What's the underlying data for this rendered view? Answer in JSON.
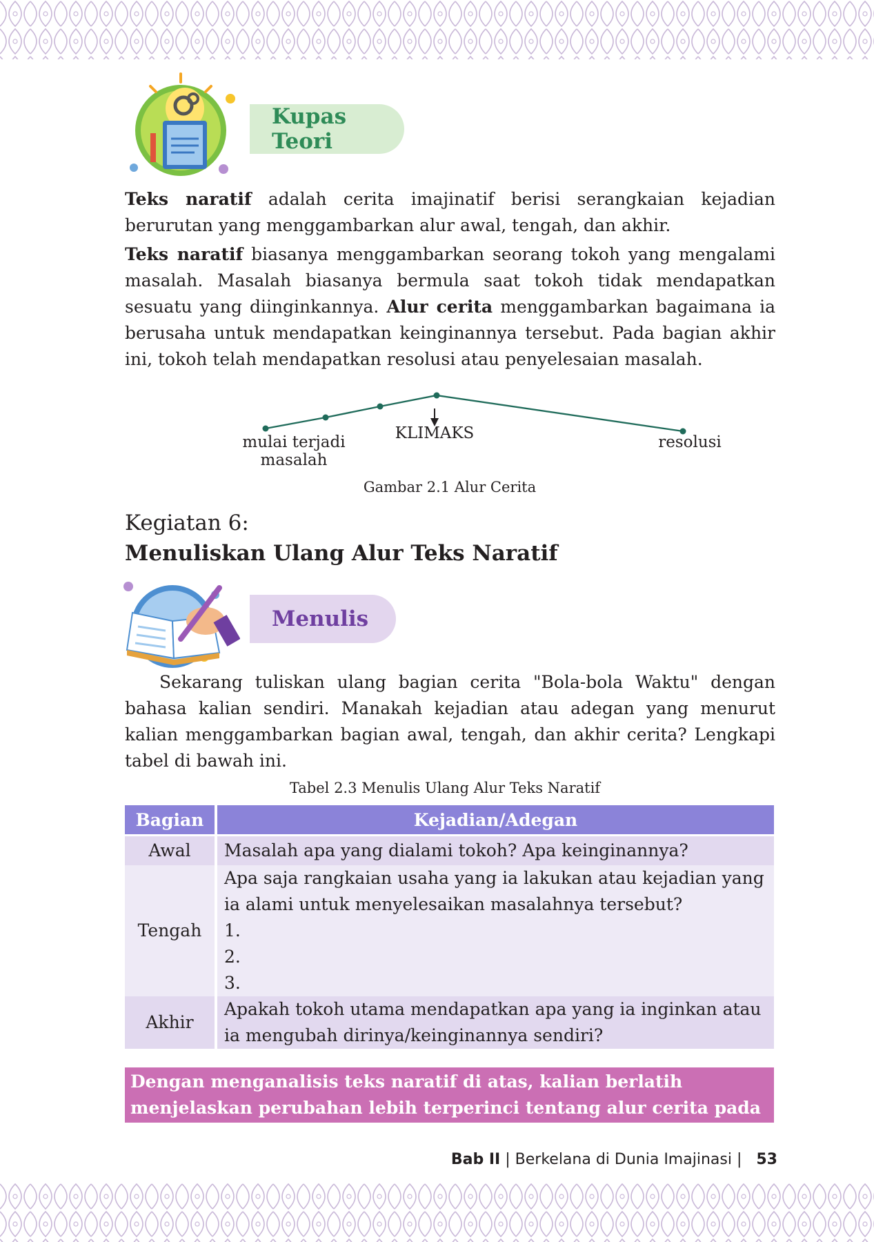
{
  "section1": {
    "badge": "Kupas Teori",
    "para1_bold": "Teks naratif",
    "para1_rest": " adalah cerita imajinatif berisi serangkaian kejadian berurutan yang menggambarkan alur awal, tengah, dan akhir.",
    "para2_bold1": "Teks naratif",
    "para2_mid": " biasanya menggambarkan seorang tokoh yang mengalami masalah. Masalah biasanya bermula saat tokoh tidak mendapatkan sesuatu yang diinginkannya. ",
    "para2_bold2": "Alur cerita",
    "para2_end": " menggambarkan bagaimana ia berusaha untuk mendapatkan keinginannya tersebut. Pada bagian akhir ini, tokoh telah mendapatkan resolusi atau penyelesaian masalah."
  },
  "figure": {
    "label_start": "mulai terjadi masalah",
    "label_peak": "KLIMAKS",
    "label_end": "resolusi",
    "caption": "Gambar 2.1 Alur Cerita",
    "line_color": "#1f6b5a"
  },
  "kegiatan": {
    "number": "Kegiatan 6:",
    "title": "Menuliskan Ulang Alur Teks Naratif"
  },
  "section2": {
    "badge": "Menulis",
    "instruction": "Sekarang tuliskan ulang bagian cerita \"Bola-bola Waktu\" dengan bahasa kalian sendiri. Manakah kejadian atau adegan yang menurut kalian menggambarkan bagian awal, tengah, dan akhir cerita? Lengkapi tabel di bawah ini."
  },
  "table": {
    "caption": "Tabel 2.3 Menulis Ulang Alur Teks Naratif",
    "headers": [
      "Bagian",
      "Kejadian/Adegan"
    ],
    "rows": [
      {
        "part": "Awal",
        "text": "Masalah apa yang dialami tokoh? Apa keinginannya?"
      },
      {
        "part": "Tengah",
        "text": "Apa saja rangkaian usaha yang ia lakukan atau kejadian yang ia alami untuk menyelesaikan masalahnya tersebut?",
        "items": [
          "1.",
          "2.",
          "3."
        ]
      },
      {
        "part": "Akhir",
        "text": "Apakah tokoh utama mendapatkan apa yang ia inginkan atau ia mengubah dirinya/keinginannya sendiri?"
      }
    ]
  },
  "conclusion": "Dengan menganalisis teks naratif di atas, kalian berlatih menjelaskan perubahan lebih terperinci tentang alur cerita pada teks naratif.",
  "footer": {
    "chapter": "Bab II",
    "title": "Berkelana di Dunia Imajinasi",
    "page": "53"
  },
  "colors": {
    "pattern": "#c9b8d8",
    "header_purple": "#8b83d9",
    "conclusion_pink": "#cb6fb4"
  }
}
